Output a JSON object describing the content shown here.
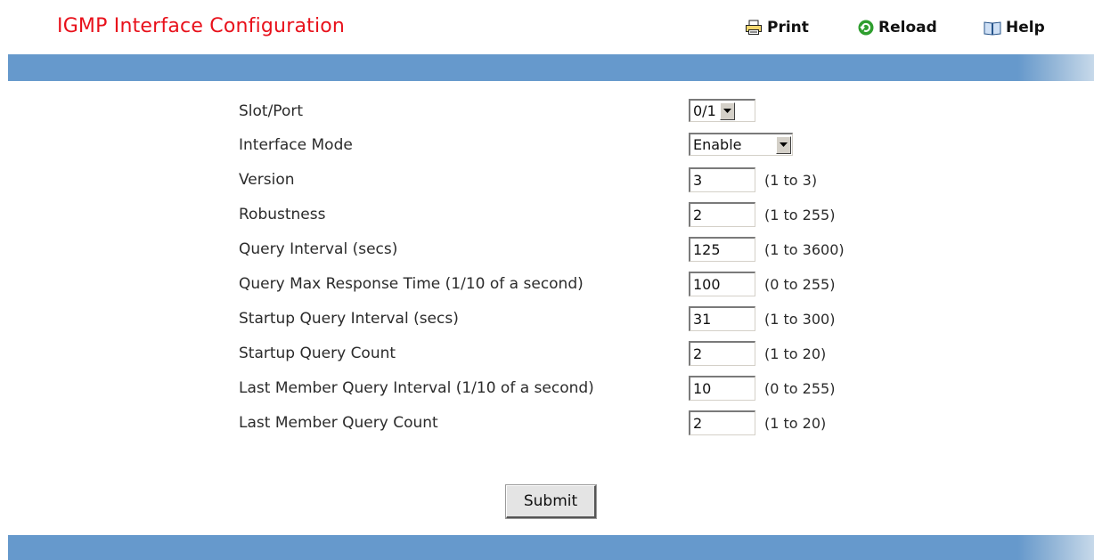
{
  "header": {
    "title": "IGMP Interface Configuration",
    "print_label": "Print",
    "reload_label": "Reload",
    "help_label": "Help"
  },
  "colors": {
    "title": "#e8111b",
    "bar": "#6699cc"
  },
  "form": {
    "slot_port": {
      "label": "Slot/Port",
      "value": "0/1"
    },
    "interface_mode": {
      "label": "Interface Mode",
      "value": "Enable"
    },
    "version": {
      "label": "Version",
      "value": "3",
      "range": "(1 to 3)"
    },
    "robustness": {
      "label": "Robustness",
      "value": "2",
      "range": "(1 to 255)"
    },
    "query_interval": {
      "label": "Query Interval (secs)",
      "value": "125",
      "range": "(1 to 3600)"
    },
    "query_max_response": {
      "label": "Query Max Response Time (1/10 of a second)",
      "value": "100",
      "range": "(0 to 255)"
    },
    "startup_query_interval": {
      "label": "Startup Query Interval (secs)",
      "value": "31",
      "range": "(1 to 300)"
    },
    "startup_query_count": {
      "label": "Startup Query Count",
      "value": "2",
      "range": "(1 to 20)"
    },
    "last_member_query_interval": {
      "label": "Last Member Query Interval (1/10 of a second)",
      "value": "10",
      "range": "(0 to 255)"
    },
    "last_member_query_count": {
      "label": "Last Member Query Count",
      "value": "2",
      "range": "(1 to 20)"
    }
  },
  "submit_label": "Submit"
}
